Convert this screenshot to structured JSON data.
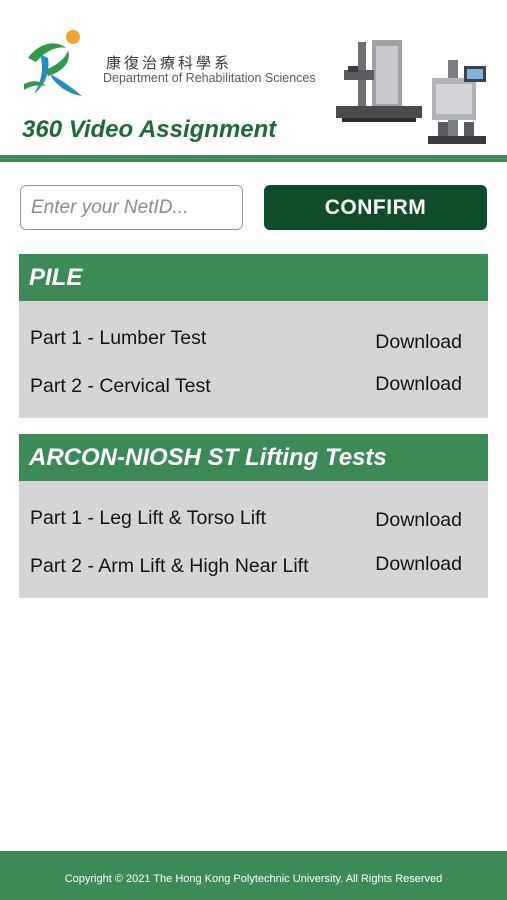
{
  "header": {
    "dept_name_cn": "康復治療科學系",
    "dept_name_en": "Department of Rehabilitation Sciences",
    "app_title": "360 Video Assignment"
  },
  "form": {
    "netid_placeholder": "Enter your NetID...",
    "confirm_label": "CONFIRM"
  },
  "sections": [
    {
      "title": "PILE",
      "items": [
        {
          "label": "Part 1 - Lumber Test",
          "link": "Download"
        },
        {
          "label": "Part 2 - Cervical Test",
          "link": "Download"
        }
      ]
    },
    {
      "title": "ARCON-NIOSH ST Lifting Tests",
      "items": [
        {
          "label": "Part 1 - Leg Lift & Torso Lift",
          "link": "Download"
        },
        {
          "label": "Part 2 - Arm Lift & High Near Lift",
          "link": "Download"
        }
      ]
    }
  ],
  "footer": {
    "copyright": "Copyright © 2021 The Hong Kong Polytechnic University. All Rights Reserved"
  },
  "colors": {
    "brand_green": "#3b8a58",
    "dark_green": "#0f4d2a",
    "title_green": "#1e6a38",
    "panel_gray": "#d5d5d5"
  }
}
